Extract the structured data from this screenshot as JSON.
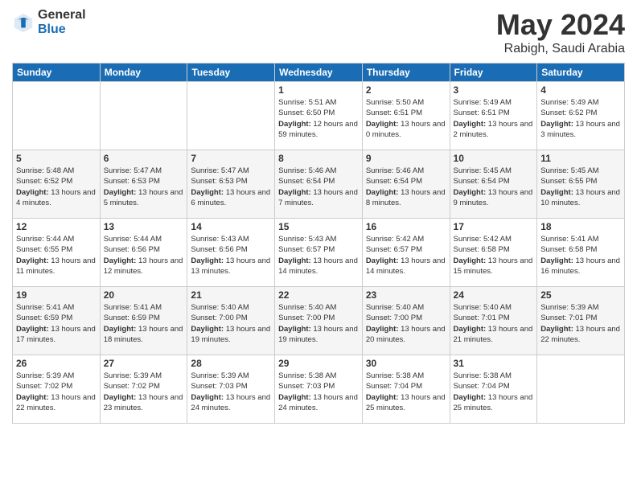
{
  "header": {
    "logo_general": "General",
    "logo_blue": "Blue",
    "month_title": "May 2024",
    "location": "Rabigh, Saudi Arabia"
  },
  "days_of_week": [
    "Sunday",
    "Monday",
    "Tuesday",
    "Wednesday",
    "Thursday",
    "Friday",
    "Saturday"
  ],
  "weeks": [
    [
      {
        "day": "",
        "info": ""
      },
      {
        "day": "",
        "info": ""
      },
      {
        "day": "",
        "info": ""
      },
      {
        "day": "1",
        "info": "Sunrise: 5:51 AM\nSunset: 6:50 PM\nDaylight: 12 hours and 59 minutes."
      },
      {
        "day": "2",
        "info": "Sunrise: 5:50 AM\nSunset: 6:51 PM\nDaylight: 13 hours and 0 minutes."
      },
      {
        "day": "3",
        "info": "Sunrise: 5:49 AM\nSunset: 6:51 PM\nDaylight: 13 hours and 2 minutes."
      },
      {
        "day": "4",
        "info": "Sunrise: 5:49 AM\nSunset: 6:52 PM\nDaylight: 13 hours and 3 minutes."
      }
    ],
    [
      {
        "day": "5",
        "info": "Sunrise: 5:48 AM\nSunset: 6:52 PM\nDaylight: 13 hours and 4 minutes."
      },
      {
        "day": "6",
        "info": "Sunrise: 5:47 AM\nSunset: 6:53 PM\nDaylight: 13 hours and 5 minutes."
      },
      {
        "day": "7",
        "info": "Sunrise: 5:47 AM\nSunset: 6:53 PM\nDaylight: 13 hours and 6 minutes."
      },
      {
        "day": "8",
        "info": "Sunrise: 5:46 AM\nSunset: 6:54 PM\nDaylight: 13 hours and 7 minutes."
      },
      {
        "day": "9",
        "info": "Sunrise: 5:46 AM\nSunset: 6:54 PM\nDaylight: 13 hours and 8 minutes."
      },
      {
        "day": "10",
        "info": "Sunrise: 5:45 AM\nSunset: 6:54 PM\nDaylight: 13 hours and 9 minutes."
      },
      {
        "day": "11",
        "info": "Sunrise: 5:45 AM\nSunset: 6:55 PM\nDaylight: 13 hours and 10 minutes."
      }
    ],
    [
      {
        "day": "12",
        "info": "Sunrise: 5:44 AM\nSunset: 6:55 PM\nDaylight: 13 hours and 11 minutes."
      },
      {
        "day": "13",
        "info": "Sunrise: 5:44 AM\nSunset: 6:56 PM\nDaylight: 13 hours and 12 minutes."
      },
      {
        "day": "14",
        "info": "Sunrise: 5:43 AM\nSunset: 6:56 PM\nDaylight: 13 hours and 13 minutes."
      },
      {
        "day": "15",
        "info": "Sunrise: 5:43 AM\nSunset: 6:57 PM\nDaylight: 13 hours and 14 minutes."
      },
      {
        "day": "16",
        "info": "Sunrise: 5:42 AM\nSunset: 6:57 PM\nDaylight: 13 hours and 14 minutes."
      },
      {
        "day": "17",
        "info": "Sunrise: 5:42 AM\nSunset: 6:58 PM\nDaylight: 13 hours and 15 minutes."
      },
      {
        "day": "18",
        "info": "Sunrise: 5:41 AM\nSunset: 6:58 PM\nDaylight: 13 hours and 16 minutes."
      }
    ],
    [
      {
        "day": "19",
        "info": "Sunrise: 5:41 AM\nSunset: 6:59 PM\nDaylight: 13 hours and 17 minutes."
      },
      {
        "day": "20",
        "info": "Sunrise: 5:41 AM\nSunset: 6:59 PM\nDaylight: 13 hours and 18 minutes."
      },
      {
        "day": "21",
        "info": "Sunrise: 5:40 AM\nSunset: 7:00 PM\nDaylight: 13 hours and 19 minutes."
      },
      {
        "day": "22",
        "info": "Sunrise: 5:40 AM\nSunset: 7:00 PM\nDaylight: 13 hours and 19 minutes."
      },
      {
        "day": "23",
        "info": "Sunrise: 5:40 AM\nSunset: 7:00 PM\nDaylight: 13 hours and 20 minutes."
      },
      {
        "day": "24",
        "info": "Sunrise: 5:40 AM\nSunset: 7:01 PM\nDaylight: 13 hours and 21 minutes."
      },
      {
        "day": "25",
        "info": "Sunrise: 5:39 AM\nSunset: 7:01 PM\nDaylight: 13 hours and 22 minutes."
      }
    ],
    [
      {
        "day": "26",
        "info": "Sunrise: 5:39 AM\nSunset: 7:02 PM\nDaylight: 13 hours and 22 minutes."
      },
      {
        "day": "27",
        "info": "Sunrise: 5:39 AM\nSunset: 7:02 PM\nDaylight: 13 hours and 23 minutes."
      },
      {
        "day": "28",
        "info": "Sunrise: 5:39 AM\nSunset: 7:03 PM\nDaylight: 13 hours and 24 minutes."
      },
      {
        "day": "29",
        "info": "Sunrise: 5:38 AM\nSunset: 7:03 PM\nDaylight: 13 hours and 24 minutes."
      },
      {
        "day": "30",
        "info": "Sunrise: 5:38 AM\nSunset: 7:04 PM\nDaylight: 13 hours and 25 minutes."
      },
      {
        "day": "31",
        "info": "Sunrise: 5:38 AM\nSunset: 7:04 PM\nDaylight: 13 hours and 25 minutes."
      },
      {
        "day": "",
        "info": ""
      }
    ]
  ]
}
